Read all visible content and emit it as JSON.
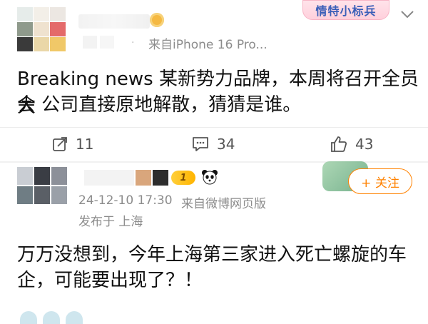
{
  "post1": {
    "source": "来自iPhone 16 Pro...",
    "text_line1": "Breaking news 某新势力品牌，本周将召开全员大",
    "text_line2": "会 公司直接原地解散，猜猜是谁。",
    "badge_text": "情特小标兵",
    "more_icon": "chevron-down-icon"
  },
  "actions": {
    "repost_count": "11",
    "comment_count": "34",
    "like_count": "43"
  },
  "post2": {
    "timestamp": "24-12-10 17:30",
    "source": "来自微博网页版",
    "location": "发布于 上海",
    "level_badge": "1",
    "follow_label": "+ 关注",
    "text_line1": "万万没想到，今年上海第三家进入死亡螺旋的车",
    "text_line2": "企，可能要出现了？！"
  },
  "colors": {
    "accent_orange": "#ff8200",
    "meta_gray": "#8c8c8c"
  }
}
